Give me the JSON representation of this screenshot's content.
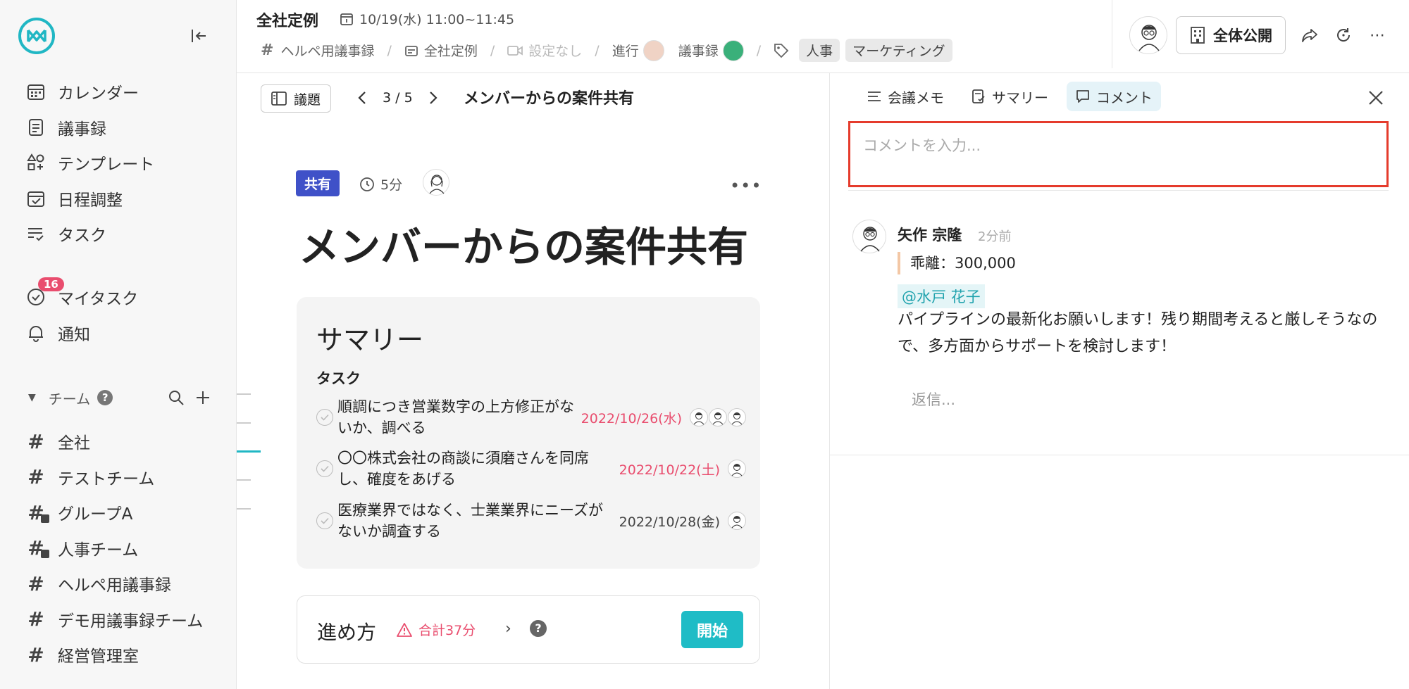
{
  "app": {
    "brand_color": "#20b7c4",
    "accent_pink": "#e94d6e"
  },
  "sidebar": {
    "items": [
      {
        "icon": "calendar-icon",
        "label": "カレンダー"
      },
      {
        "icon": "minutes-icon",
        "label": "議事録"
      },
      {
        "icon": "template-icon",
        "label": "テンプレート"
      },
      {
        "icon": "schedule-icon",
        "label": "日程調整"
      },
      {
        "icon": "task-icon",
        "label": "タスク"
      }
    ],
    "my_tasks": {
      "label": "マイタスク",
      "badge": "16"
    },
    "notifications": {
      "label": "通知"
    },
    "team_header": "チーム",
    "teams": [
      {
        "label": "全社",
        "locked": false
      },
      {
        "label": "テストチーム",
        "locked": false
      },
      {
        "label": "グループA",
        "locked": true
      },
      {
        "label": "人事チーム",
        "locked": true
      },
      {
        "label": "ヘルペ用議事録",
        "locked": false
      },
      {
        "label": "デモ用議事録チーム",
        "locked": false
      },
      {
        "label": "経営管理室",
        "locked": false
      }
    ]
  },
  "header": {
    "title": "全社定例",
    "datetime": "10/19(水) 11:00~11:45",
    "channel": "ヘルペ用議事録",
    "meeting": "全社定例",
    "video": "設定なし",
    "facilitator_label": "進行",
    "minutes_label": "議事録",
    "tags": [
      "人事",
      "マーケティング"
    ],
    "visibility": "全体公開"
  },
  "agenda": {
    "button_label": "議題",
    "position": "3 / 5",
    "topic_title": "メンバーからの案件共有",
    "share_tag": "共有",
    "duration": "5分",
    "heading": "メンバーからの案件共有"
  },
  "summary": {
    "title": "サマリー",
    "tasks_label": "タスク",
    "tasks": [
      {
        "text": "順調につき営業数字の上方修正がないか、調べる",
        "date": "2022/10/26(水)",
        "overdue": true,
        "assignees": 3
      },
      {
        "text": "〇〇株式会社の商談に須磨さんを同席し、確度をあげる",
        "date": "2022/10/22(土)",
        "overdue": true,
        "assignees": 1
      },
      {
        "text": "医療業界ではなく、士業業界にニーズがないか調査する",
        "date": "2022/10/28(金)",
        "overdue": false,
        "assignees": 1
      }
    ]
  },
  "progress": {
    "title": "進め方",
    "total": "合計37分",
    "start_label": "開始"
  },
  "panel": {
    "tabs": [
      {
        "icon": "memo-icon",
        "label": "会議メモ"
      },
      {
        "icon": "summary-icon",
        "label": "サマリー"
      },
      {
        "icon": "comment-icon",
        "label": "コメント",
        "active": true
      }
    ],
    "comment_placeholder": "コメントを入力...",
    "comment": {
      "author": "矢作 宗隆",
      "time": "2分前",
      "quote": "乖離：300,000",
      "mention": "@水戸 花子",
      "body": "パイプラインの最新化お願いします！残り期間考えると厳しそうなので、多方面からサポートを検討します！",
      "reply_placeholder": "返信..."
    }
  }
}
